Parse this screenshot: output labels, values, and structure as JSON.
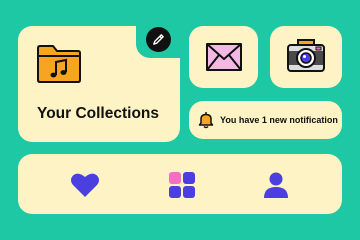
{
  "collections": {
    "title": "Your Collections"
  },
  "notification": {
    "text": "You have 1 new notification"
  },
  "colors": {
    "background": "#1ec8a5",
    "card": "#fdf3c4",
    "folder": "#f7a421",
    "envelope": "#f4b8e4",
    "heart": "#4b3fe0",
    "grid_pink": "#f46fc3",
    "grid_blue": "#4b3fe0",
    "user": "#4b3fe0",
    "bell": "#f7a421"
  },
  "icons": [
    "pencil-icon",
    "music-folder-icon",
    "envelope-icon",
    "camera-icon",
    "bell-icon",
    "heart-icon",
    "grid-icon",
    "user-icon"
  ]
}
